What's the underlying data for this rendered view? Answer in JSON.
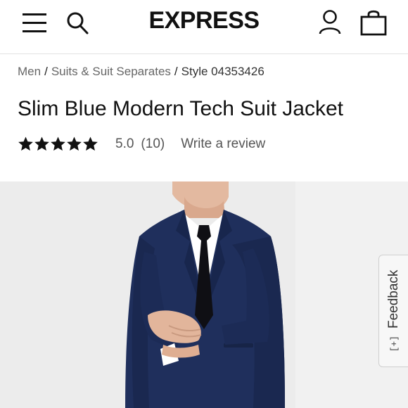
{
  "header": {
    "logo": "EXPRESS",
    "icons": [
      "menu-icon",
      "search-icon",
      "account-icon",
      "shopping-bag-icon"
    ]
  },
  "breadcrumb": {
    "items": [
      {
        "label": "Men"
      },
      {
        "label": "Suits & Suit Separates"
      },
      {
        "label": "Style 04353426"
      }
    ],
    "separator": "/"
  },
  "product": {
    "title": "Slim Blue Modern Tech Suit Jacket",
    "rating": {
      "stars_filled": 5,
      "stars_total": 5,
      "score": "5.0",
      "count": "(10)",
      "write_review": "Write a review"
    }
  },
  "feedback": {
    "icon": "[+]",
    "label": "Feedback"
  },
  "colors": {
    "suit_navy": "#1f2f5c",
    "text": "#111111",
    "muted": "#555555",
    "image_background": "#ededed"
  }
}
